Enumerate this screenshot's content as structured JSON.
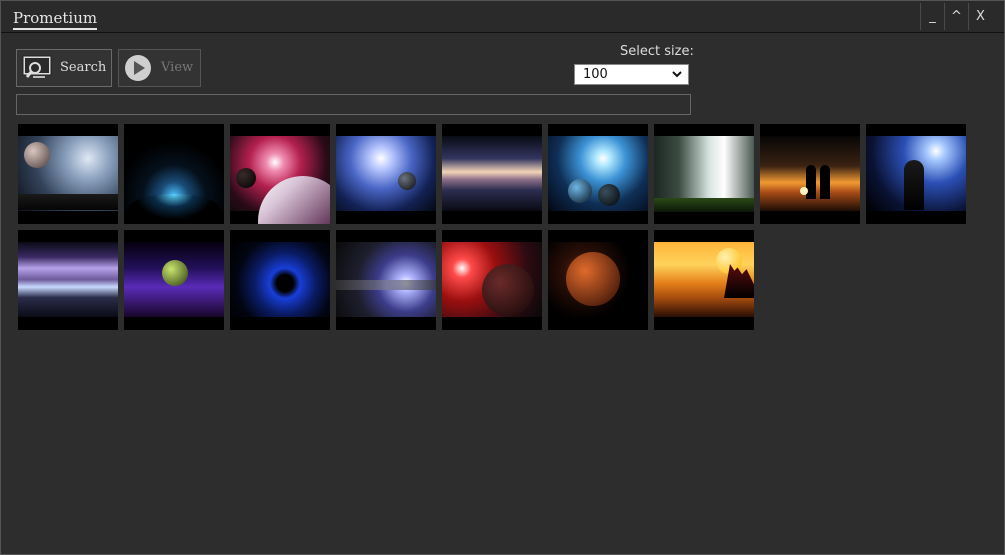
{
  "window": {
    "title": "Prometium",
    "minimize_label": "_",
    "maximize_label": "^",
    "close_label": "X"
  },
  "toolbar": {
    "search_label": "Search",
    "view_label": "View"
  },
  "size_select": {
    "label": "Select size:",
    "value": "100"
  },
  "search_input": {
    "value": ""
  },
  "gallery": {
    "thumbnail_count": 16
  }
}
